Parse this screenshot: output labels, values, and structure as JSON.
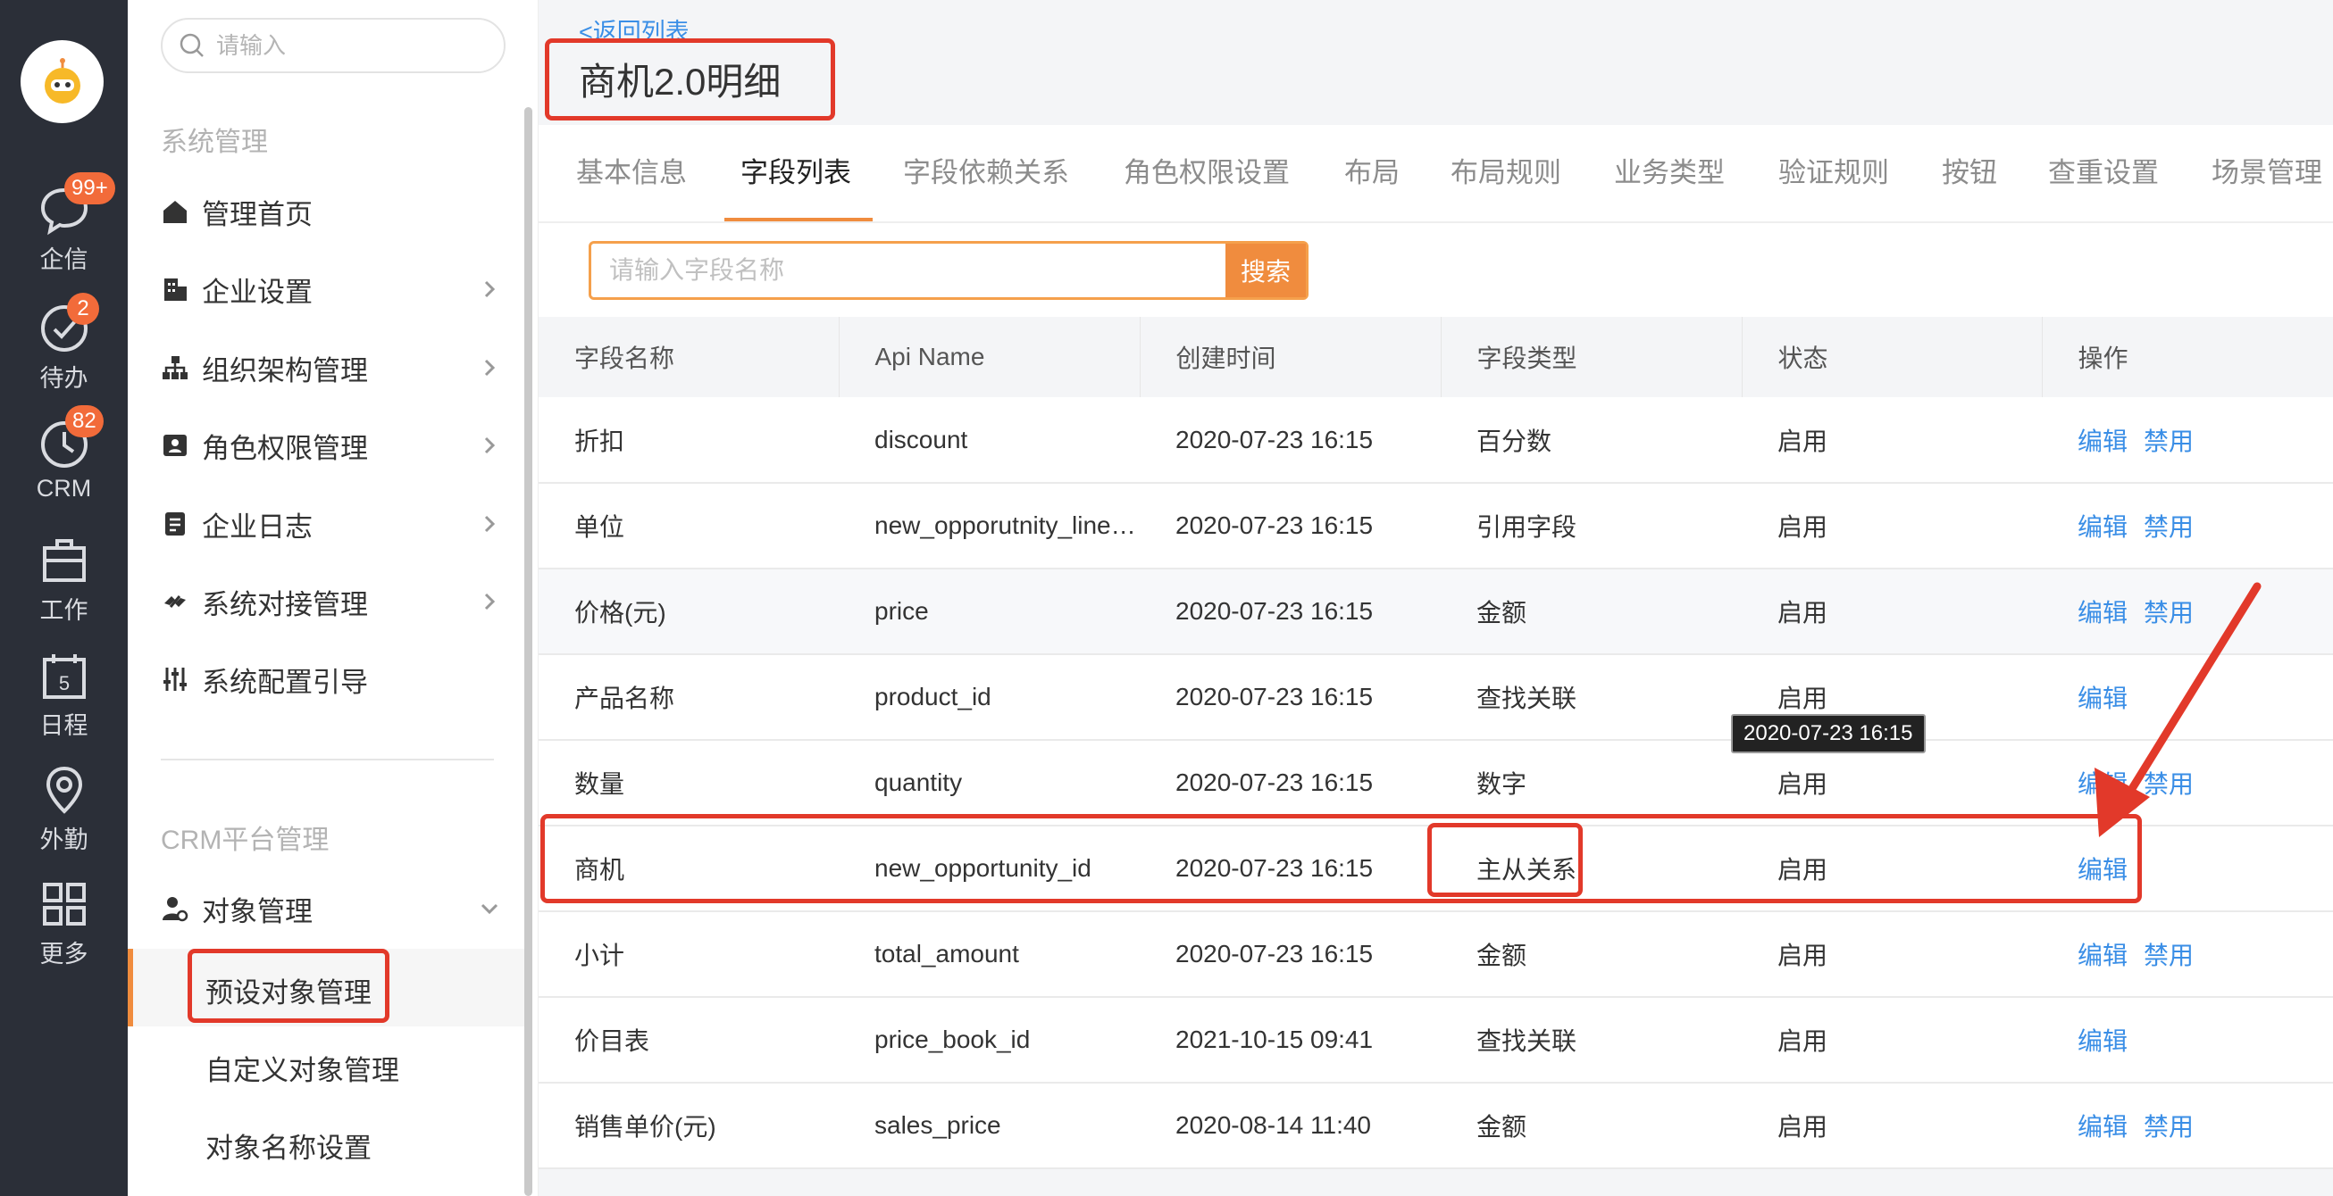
{
  "rail": {
    "items": [
      {
        "label": "企信",
        "badge": "99+",
        "icon": "chat-icon"
      },
      {
        "label": "待办",
        "badge": "2",
        "icon": "check-circle-icon"
      },
      {
        "label": "CRM",
        "badge": "82",
        "icon": "clock-icon"
      },
      {
        "label": "工作",
        "badge": "",
        "icon": "briefcase-icon"
      },
      {
        "label": "日程",
        "badge": "",
        "icon": "calendar-icon",
        "day": "5"
      },
      {
        "label": "外勤",
        "badge": "",
        "icon": "location-icon"
      },
      {
        "label": "更多",
        "badge": "",
        "icon": "grid-icon"
      }
    ]
  },
  "sidebar": {
    "search_placeholder": "请输入",
    "section_system": "系统管理",
    "items": [
      {
        "label": "管理首页",
        "icon": "home-icon"
      },
      {
        "label": "企业设置",
        "icon": "building-icon"
      },
      {
        "label": "组织架构管理",
        "icon": "org-chart-icon"
      },
      {
        "label": "角色权限管理",
        "icon": "id-card-icon"
      },
      {
        "label": "企业日志",
        "icon": "log-icon"
      },
      {
        "label": "系统对接管理",
        "icon": "link-icon"
      },
      {
        "label": "系统配置引导",
        "icon": "sliders-icon"
      }
    ],
    "section_crm": "CRM平台管理",
    "object_mgmt": "对象管理",
    "sub_items": [
      "预设对象管理",
      "自定义对象管理",
      "对象名称设置"
    ]
  },
  "header": {
    "back_link": "<返回列表",
    "title": "商机2.0明细"
  },
  "tabs": [
    "基本信息",
    "字段列表",
    "字段依赖关系",
    "角色权限设置",
    "布局",
    "布局规则",
    "业务类型",
    "验证规则",
    "按钮",
    "查重设置",
    "场景管理"
  ],
  "search": {
    "placeholder": "请输入字段名称",
    "button": "搜索"
  },
  "table": {
    "columns": [
      "字段名称",
      "Api Name",
      "创建时间",
      "字段类型",
      "状态",
      "操作"
    ],
    "rows": [
      {
        "name": "折扣",
        "api": "discount",
        "created": "2020-07-23 16:15",
        "type": "百分数",
        "status": "启用",
        "ops": [
          "编辑",
          "禁用"
        ]
      },
      {
        "name": "单位",
        "api": "new_opporutnity_line…",
        "created": "2020-07-23 16:15",
        "type": "引用字段",
        "status": "启用",
        "ops": [
          "编辑",
          "禁用"
        ]
      },
      {
        "name": "价格(元)",
        "api": "price",
        "created": "2020-07-23 16:15",
        "type": "金额",
        "status": "启用",
        "ops": [
          "编辑",
          "禁用"
        ]
      },
      {
        "name": "产品名称",
        "api": "product_id",
        "created": "2020-07-23 16:15",
        "type": "查找关联",
        "status": "启用",
        "ops": [
          "编辑"
        ]
      },
      {
        "name": "数量",
        "api": "quantity",
        "created": "2020-07-23 16:15",
        "type": "数字",
        "status": "启用",
        "ops": [
          "编辑",
          "禁用"
        ]
      },
      {
        "name": "商机",
        "api": "new_opportunity_id",
        "created": "2020-07-23 16:15",
        "type": "主从关系",
        "status": "启用",
        "ops": [
          "编辑"
        ]
      },
      {
        "name": "小计",
        "api": "total_amount",
        "created": "2020-07-23 16:15",
        "type": "金额",
        "status": "启用",
        "ops": [
          "编辑",
          "禁用"
        ]
      },
      {
        "name": "价目表",
        "api": "price_book_id",
        "created": "2021-10-15 09:41",
        "type": "查找关联",
        "status": "启用",
        "ops": [
          "编辑"
        ]
      },
      {
        "name": "销售单价(元)",
        "api": "sales_price",
        "created": "2020-08-14 11:40",
        "type": "金额",
        "status": "启用",
        "ops": [
          "编辑",
          "禁用"
        ]
      }
    ]
  },
  "tooltip": "2020-07-23 16:15",
  "colors": {
    "accent": "#f08c3e",
    "link": "#3a8ee6",
    "annotation": "#e2392a",
    "rail": "#2b2f38"
  }
}
